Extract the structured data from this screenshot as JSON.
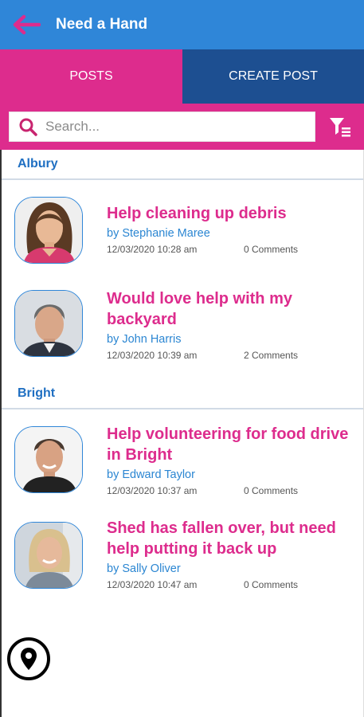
{
  "header": {
    "title": "Need a Hand",
    "back_icon": "arrow-left-icon",
    "back_color": "#dd2c8d"
  },
  "tabs": [
    {
      "label": "POSTS",
      "active": true
    },
    {
      "label": "CREATE POST",
      "active": false
    }
  ],
  "search": {
    "placeholder": "Search...",
    "value": ""
  },
  "filter": {
    "icon": "filter-list-icon"
  },
  "groups": [
    {
      "name": "Albury",
      "posts": [
        {
          "title": "Help cleaning up debris",
          "author": "by Stephanie Maree",
          "date": "12/03/2020 10:28 am",
          "comments": "0 Comments",
          "avatar": "woman-dark-hair"
        },
        {
          "title": "Would love help with my backyard",
          "author": "by John Harris",
          "date": "12/03/2020 10:39 am",
          "comments": "2 Comments",
          "avatar": "man-grey-hair"
        }
      ]
    },
    {
      "name": "Bright",
      "posts": [
        {
          "title": "Help volunteering for food drive in Bright",
          "author": "by Edward Taylor",
          "date": "12/03/2020 10:37 am",
          "comments": "0 Comments",
          "avatar": "man-dark-hair"
        },
        {
          "title": "Shed has fallen over, but need help putting it back up",
          "author": "by Sally Oliver",
          "date": "12/03/2020 10:47 am",
          "comments": "0 Comments",
          "avatar": "woman-blonde-hair"
        }
      ]
    }
  ],
  "map_button": {
    "icon": "location-pin-icon"
  },
  "colors": {
    "primary_blue": "#2f86d8",
    "accent_pink": "#dd2c8d",
    "dark_blue": "#1d4f91",
    "group_blue": "#1f6fc2"
  }
}
